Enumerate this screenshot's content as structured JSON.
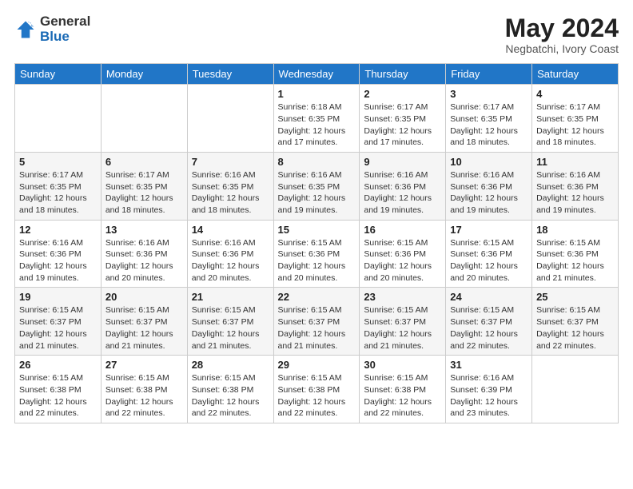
{
  "logo": {
    "general": "General",
    "blue": "Blue"
  },
  "title": "May 2024",
  "location": "Negbatchi, Ivory Coast",
  "header_days": [
    "Sunday",
    "Monday",
    "Tuesday",
    "Wednesday",
    "Thursday",
    "Friday",
    "Saturday"
  ],
  "weeks": [
    [
      {
        "day": "",
        "info": ""
      },
      {
        "day": "",
        "info": ""
      },
      {
        "day": "",
        "info": ""
      },
      {
        "day": "1",
        "info": "Sunrise: 6:18 AM\nSunset: 6:35 PM\nDaylight: 12 hours and 17 minutes."
      },
      {
        "day": "2",
        "info": "Sunrise: 6:17 AM\nSunset: 6:35 PM\nDaylight: 12 hours and 17 minutes."
      },
      {
        "day": "3",
        "info": "Sunrise: 6:17 AM\nSunset: 6:35 PM\nDaylight: 12 hours and 18 minutes."
      },
      {
        "day": "4",
        "info": "Sunrise: 6:17 AM\nSunset: 6:35 PM\nDaylight: 12 hours and 18 minutes."
      }
    ],
    [
      {
        "day": "5",
        "info": "Sunrise: 6:17 AM\nSunset: 6:35 PM\nDaylight: 12 hours and 18 minutes."
      },
      {
        "day": "6",
        "info": "Sunrise: 6:17 AM\nSunset: 6:35 PM\nDaylight: 12 hours and 18 minutes."
      },
      {
        "day": "7",
        "info": "Sunrise: 6:16 AM\nSunset: 6:35 PM\nDaylight: 12 hours and 18 minutes."
      },
      {
        "day": "8",
        "info": "Sunrise: 6:16 AM\nSunset: 6:35 PM\nDaylight: 12 hours and 19 minutes."
      },
      {
        "day": "9",
        "info": "Sunrise: 6:16 AM\nSunset: 6:36 PM\nDaylight: 12 hours and 19 minutes."
      },
      {
        "day": "10",
        "info": "Sunrise: 6:16 AM\nSunset: 6:36 PM\nDaylight: 12 hours and 19 minutes."
      },
      {
        "day": "11",
        "info": "Sunrise: 6:16 AM\nSunset: 6:36 PM\nDaylight: 12 hours and 19 minutes."
      }
    ],
    [
      {
        "day": "12",
        "info": "Sunrise: 6:16 AM\nSunset: 6:36 PM\nDaylight: 12 hours and 19 minutes."
      },
      {
        "day": "13",
        "info": "Sunrise: 6:16 AM\nSunset: 6:36 PM\nDaylight: 12 hours and 20 minutes."
      },
      {
        "day": "14",
        "info": "Sunrise: 6:16 AM\nSunset: 6:36 PM\nDaylight: 12 hours and 20 minutes."
      },
      {
        "day": "15",
        "info": "Sunrise: 6:15 AM\nSunset: 6:36 PM\nDaylight: 12 hours and 20 minutes."
      },
      {
        "day": "16",
        "info": "Sunrise: 6:15 AM\nSunset: 6:36 PM\nDaylight: 12 hours and 20 minutes."
      },
      {
        "day": "17",
        "info": "Sunrise: 6:15 AM\nSunset: 6:36 PM\nDaylight: 12 hours and 20 minutes."
      },
      {
        "day": "18",
        "info": "Sunrise: 6:15 AM\nSunset: 6:36 PM\nDaylight: 12 hours and 21 minutes."
      }
    ],
    [
      {
        "day": "19",
        "info": "Sunrise: 6:15 AM\nSunset: 6:37 PM\nDaylight: 12 hours and 21 minutes."
      },
      {
        "day": "20",
        "info": "Sunrise: 6:15 AM\nSunset: 6:37 PM\nDaylight: 12 hours and 21 minutes."
      },
      {
        "day": "21",
        "info": "Sunrise: 6:15 AM\nSunset: 6:37 PM\nDaylight: 12 hours and 21 minutes."
      },
      {
        "day": "22",
        "info": "Sunrise: 6:15 AM\nSunset: 6:37 PM\nDaylight: 12 hours and 21 minutes."
      },
      {
        "day": "23",
        "info": "Sunrise: 6:15 AM\nSunset: 6:37 PM\nDaylight: 12 hours and 21 minutes."
      },
      {
        "day": "24",
        "info": "Sunrise: 6:15 AM\nSunset: 6:37 PM\nDaylight: 12 hours and 22 minutes."
      },
      {
        "day": "25",
        "info": "Sunrise: 6:15 AM\nSunset: 6:37 PM\nDaylight: 12 hours and 22 minutes."
      }
    ],
    [
      {
        "day": "26",
        "info": "Sunrise: 6:15 AM\nSunset: 6:38 PM\nDaylight: 12 hours and 22 minutes."
      },
      {
        "day": "27",
        "info": "Sunrise: 6:15 AM\nSunset: 6:38 PM\nDaylight: 12 hours and 22 minutes."
      },
      {
        "day": "28",
        "info": "Sunrise: 6:15 AM\nSunset: 6:38 PM\nDaylight: 12 hours and 22 minutes."
      },
      {
        "day": "29",
        "info": "Sunrise: 6:15 AM\nSunset: 6:38 PM\nDaylight: 12 hours and 22 minutes."
      },
      {
        "day": "30",
        "info": "Sunrise: 6:15 AM\nSunset: 6:38 PM\nDaylight: 12 hours and 22 minutes."
      },
      {
        "day": "31",
        "info": "Sunrise: 6:16 AM\nSunset: 6:39 PM\nDaylight: 12 hours and 23 minutes."
      },
      {
        "day": "",
        "info": ""
      }
    ]
  ]
}
